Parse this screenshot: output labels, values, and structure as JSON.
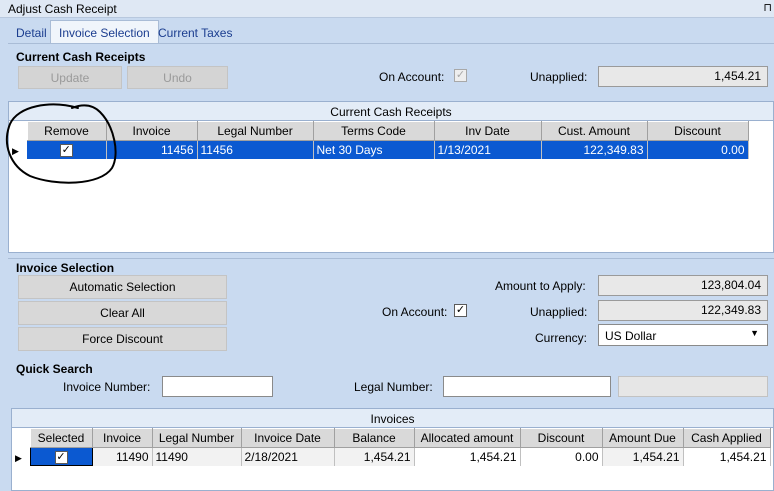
{
  "window": {
    "title": "Adjust Cash Receipt",
    "pin_icon": "pin-icon"
  },
  "tabs": [
    {
      "label": "Detail"
    },
    {
      "label": "Invoice Selection"
    },
    {
      "label": "Current Taxes"
    }
  ],
  "current_cash_receipts": {
    "section_title": "Current Cash Receipts",
    "update_label": "Update",
    "undo_label": "Undo",
    "on_account_label": "On Account:",
    "on_account_checked": true,
    "unapplied_label": "Unapplied:",
    "unapplied_value": "1,454.21",
    "grid": {
      "caption": "Current Cash Receipts",
      "columns": [
        "Remove",
        "Invoice",
        "Legal Number",
        "Terms Code",
        "Inv Date",
        "Cust. Amount",
        "Discount"
      ],
      "rows": [
        {
          "remove": true,
          "invoice": "11456",
          "legal_number": "11456",
          "terms_code": "Net 30 Days",
          "inv_date": "1/13/2021",
          "cust_amount": "122,349.83",
          "discount": "0.00"
        }
      ]
    }
  },
  "invoice_selection": {
    "section_title": "Invoice Selection",
    "automatic_selection_label": "Automatic Selection",
    "clear_all_label": "Clear All",
    "force_discount_label": "Force Discount",
    "amount_to_apply_label": "Amount to Apply:",
    "amount_to_apply_value": "123,804.04",
    "on_account_label": "On Account:",
    "on_account_checked": true,
    "unapplied_label": "Unapplied:",
    "unapplied_value": "122,349.83",
    "currency_label": "Currency:",
    "currency_value": "US Dollar"
  },
  "quick_search": {
    "section_title": "Quick Search",
    "invoice_number_label": "Invoice Number:",
    "invoice_number_value": "",
    "legal_number_label": "Legal Number:",
    "legal_number_value": ""
  },
  "invoices_grid": {
    "caption": "Invoices",
    "columns": [
      "Selected",
      "Invoice",
      "Legal Number",
      "Invoice Date",
      "Balance",
      "Allocated amount",
      "Discount",
      "Amount Due",
      "Cash Applied"
    ],
    "rows": [
      {
        "selected": true,
        "invoice": "11490",
        "legal_number": "11490",
        "invoice_date": "2/18/2021",
        "balance": "1,454.21",
        "allocated_amount": "1,454.21",
        "discount": "0.00",
        "amount_due": "1,454.21",
        "cash_applied": "1,454.21"
      }
    ]
  },
  "colors": {
    "selection_blue": "#0b59d1",
    "panel_bg": "#c9daf0",
    "annotation": "#000000"
  }
}
